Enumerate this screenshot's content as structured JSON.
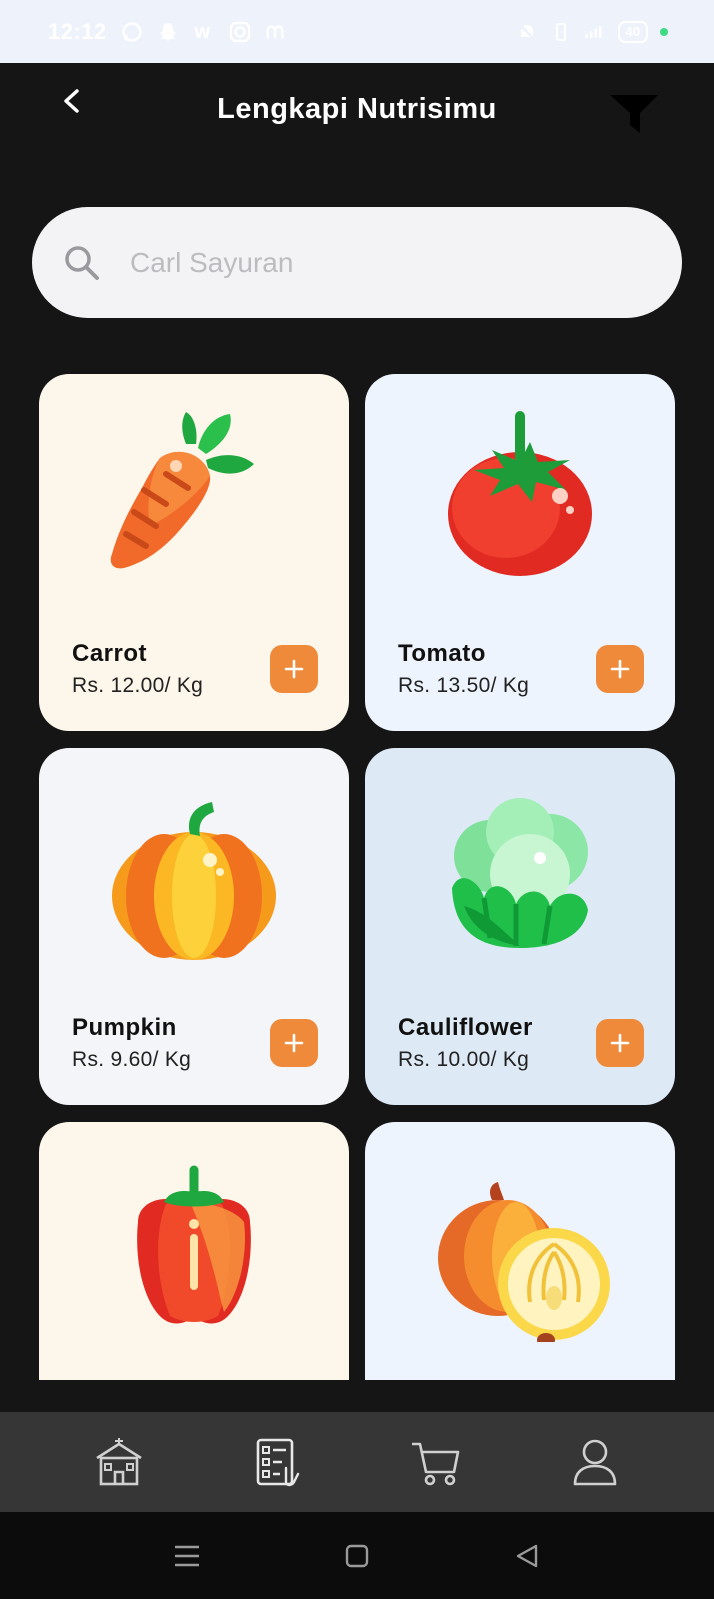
{
  "status_bar": {
    "time": "12:12",
    "battery": "40",
    "icons": [
      "whatsapp-icon",
      "snapchat-icon",
      "wechat-icon",
      "instagram-icon",
      "messenger-icon",
      "mute-icon",
      "vibrate-icon",
      "signal-icon",
      "battery-icon"
    ]
  },
  "header": {
    "title": "Lengkapi Nutrisimu",
    "back_icon": "chevron-left-icon",
    "filter_icon": "filter-icon"
  },
  "search": {
    "placeholder": "Carl Sayuran",
    "value": ""
  },
  "products": [
    {
      "name": "Carrot",
      "price": "Rs. 12.00/ Kg",
      "bg": "#fdf6ea",
      "icon": "carrot-icon"
    },
    {
      "name": "Tomato",
      "price": "Rs. 13.50/ Kg",
      "bg": "#edf4fd",
      "icon": "tomato-icon"
    },
    {
      "name": "Pumpkin",
      "price": "Rs. 9.60/ Kg",
      "bg": "#f3f5f8",
      "icon": "pumpkin-icon"
    },
    {
      "name": "Cauliflower",
      "price": "Rs. 10.00/ Kg",
      "bg": "#dde9f5",
      "icon": "cauliflower-icon"
    },
    {
      "name": "",
      "price": "",
      "bg": "#fdf6ea",
      "icon": "bell-pepper-icon"
    },
    {
      "name": "",
      "price": "",
      "bg": "#edf4fd",
      "icon": "onion-icon"
    }
  ],
  "colors": {
    "accent": "#ee8a3a",
    "background": "#151515",
    "nav_bg": "#363636"
  },
  "bottom_nav": [
    "home-icon",
    "checklist-icon",
    "cart-icon",
    "profile-icon"
  ],
  "system_nav": [
    "menu-icon",
    "home-square-icon",
    "back-triangle-icon"
  ]
}
